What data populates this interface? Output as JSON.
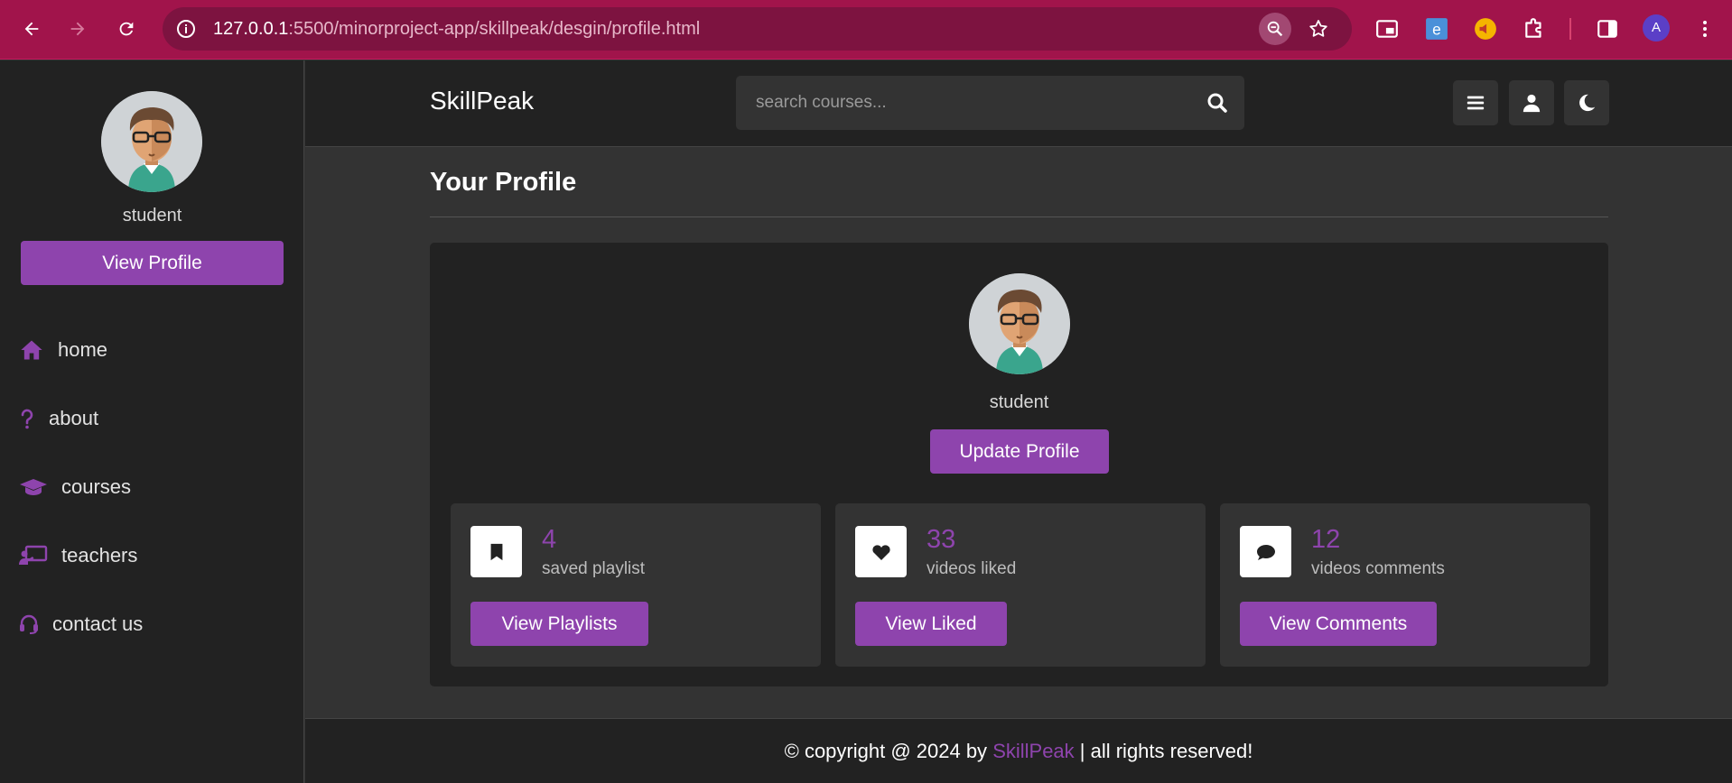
{
  "browser": {
    "url_host": "127.0.0.1",
    "url_rest": ":5500/minorproject-app/skillpeak/desgin/profile.html",
    "profile_initial": "A"
  },
  "header": {
    "logo": "SkillPeak",
    "search_placeholder": "search courses..."
  },
  "sidebar": {
    "user_name": "student",
    "view_profile_label": "View Profile",
    "items": [
      {
        "label": "home",
        "icon": "home-icon"
      },
      {
        "label": "about",
        "icon": "question-icon"
      },
      {
        "label": "courses",
        "icon": "graduation-cap-icon"
      },
      {
        "label": "teachers",
        "icon": "chalkboard-teacher-icon"
      },
      {
        "label": "contact us",
        "icon": "headset-icon"
      }
    ]
  },
  "main": {
    "title": "Your Profile",
    "user_name": "student",
    "update_label": "Update Profile",
    "stats": [
      {
        "value": "4",
        "label": "saved playlist",
        "button": "View Playlists",
        "icon": "bookmark-icon"
      },
      {
        "value": "33",
        "label": "videos liked",
        "button": "View Liked",
        "icon": "heart-icon"
      },
      {
        "value": "12",
        "label": "videos comments",
        "button": "View Comments",
        "icon": "comment-icon"
      }
    ]
  },
  "footer": {
    "prefix": "© copyright @ 2024 by ",
    "brand": "SkillPeak",
    "suffix": " | all rights reserved!"
  },
  "colors": {
    "accent": "#8e44ad",
    "panel": "#222222",
    "background": "#333333",
    "chrome": "#a1144b"
  }
}
